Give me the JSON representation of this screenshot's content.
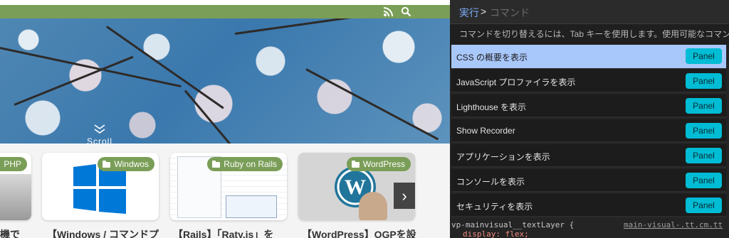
{
  "header": {
    "rss_icon": "rss-icon",
    "search_icon": "search-icon",
    "accent": "#7a9e57"
  },
  "hero": {
    "scroll_label": "Scroll",
    "scroll_icon": "chevron-down-double-icon"
  },
  "cards": [
    {
      "category": "PHP",
      "title": "機で"
    },
    {
      "category": "Windwos",
      "title": "【Windows / コマンドプ"
    },
    {
      "category": "Ruby on Rails",
      "title": "【Rails】「Raty.js」を"
    },
    {
      "category": "WordPress",
      "title": "【WordPress】OGPを設"
    }
  ],
  "next_arrow": "›",
  "command_menu": {
    "prefix": "実行",
    "caret": ">",
    "placeholder": "コマンド",
    "hint": "コマンドを切り替えるには、Tab キーを使用します。使用可能なコマン",
    "items": [
      {
        "label": "CSS の概要を表示",
        "badge": "Panel"
      },
      {
        "label": "JavaScript プロファイラを表示",
        "badge": "Panel"
      },
      {
        "label": "Lighthouse を表示",
        "badge": "Panel"
      },
      {
        "label": "Show Recorder",
        "badge": "Panel"
      },
      {
        "label": "アプリケーションを表示",
        "badge": "Panel"
      },
      {
        "label": "コンソールを表示",
        "badge": "Panel"
      },
      {
        "label": "セキュリティを表示",
        "badge": "Panel"
      }
    ],
    "selected_index": 0,
    "highlight_color": "#a8c7fa",
    "badge_color": "#00bcd4"
  },
  "code_behind": {
    "line1_left": "vp-mainvisual__textLayer {",
    "line1_right": "main-visual-.tt.cm.tt",
    "line2": "display: flex;"
  }
}
